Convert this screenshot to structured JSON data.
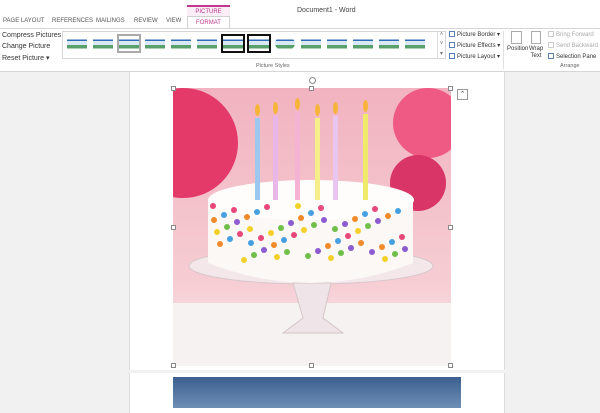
{
  "window": {
    "title": "Document1 - Word",
    "context_tab": "PICTURE TOOLS"
  },
  "tabs": [
    "PAGE LAYOUT",
    "REFERENCES",
    "MAILINGS",
    "REVIEW",
    "VIEW",
    "FORMAT"
  ],
  "active_tab": "FORMAT",
  "adjust": {
    "compress": "Compress Pictures",
    "change": "Change Picture",
    "reset": "Reset Picture"
  },
  "picture_styles": {
    "label": "Picture Styles",
    "count": 14,
    "picture_border": "Picture Border",
    "picture_effects": "Picture Effects",
    "picture_layout": "Picture Layout"
  },
  "arrange": {
    "label": "Arrange",
    "position": "Position",
    "wrap_text": "Wrap Text",
    "bring_forward": "Bring Forward",
    "send_backward": "Send Backward",
    "selection_pane": "Selection Pane"
  },
  "colors": {
    "accent": "#c0398d",
    "cake_bg": "#f0a8b8"
  }
}
